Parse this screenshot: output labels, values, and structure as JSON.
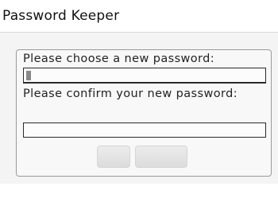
{
  "app": {
    "title": "Password Keeper"
  },
  "dialog": {
    "new_password_label": "Please choose a new password:",
    "confirm_password_label": "Please confirm your new password:",
    "new_password_value": "",
    "confirm_password_value": "",
    "buttons": {
      "ok_label": "",
      "cancel_label": ""
    }
  },
  "colors": {
    "background": "#ffffff",
    "dialog_bg": "#f8f8f8",
    "field_border": "#2a2a2a"
  },
  "icons": {
    "caret": "text-cursor-icon"
  }
}
